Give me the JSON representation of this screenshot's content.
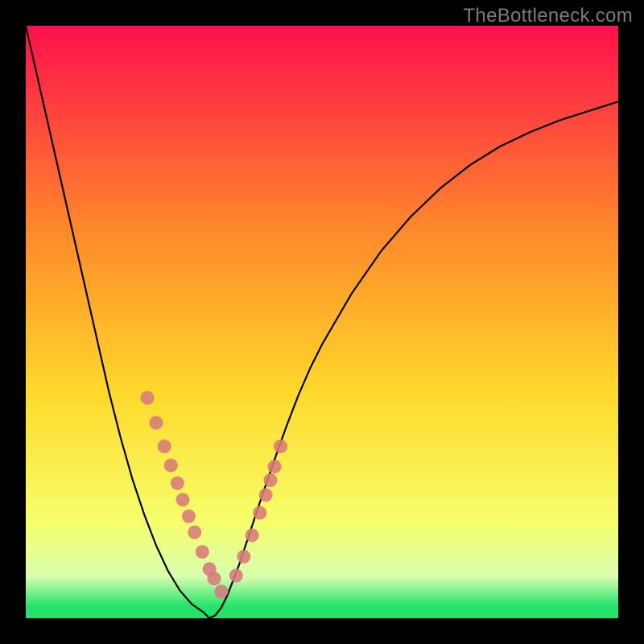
{
  "watermark": "TheBottleneck.com",
  "colors": {
    "gradient_top": "#ff0f4d",
    "gradient_upper_mid": "#ff8a2a",
    "gradient_mid": "#ffd92a",
    "gradient_lower_mid": "#f6ff6b",
    "gradient_above_green": "#d8ffb0",
    "gradient_green": "#23e36a",
    "curve": "#000000",
    "dot": "#d87a7a",
    "background": "#000000"
  },
  "chart_data": {
    "type": "line",
    "title": "",
    "xlabel": "",
    "ylabel": "",
    "x": [
      0.0,
      0.02,
      0.04,
      0.06,
      0.08,
      0.1,
      0.12,
      0.14,
      0.16,
      0.18,
      0.2,
      0.22,
      0.24,
      0.26,
      0.28,
      0.3,
      0.31,
      0.32,
      0.33,
      0.34,
      0.36,
      0.38,
      0.4,
      0.42,
      0.44,
      0.46,
      0.48,
      0.5,
      0.55,
      0.6,
      0.65,
      0.7,
      0.75,
      0.8,
      0.85,
      0.9,
      0.95,
      1.0
    ],
    "y": [
      1.0,
      0.912,
      0.824,
      0.736,
      0.648,
      0.56,
      0.472,
      0.384,
      0.305,
      0.235,
      0.175,
      0.123,
      0.08,
      0.047,
      0.024,
      0.01,
      0.0,
      0.005,
      0.018,
      0.038,
      0.09,
      0.15,
      0.21,
      0.268,
      0.324,
      0.376,
      0.422,
      0.462,
      0.548,
      0.62,
      0.678,
      0.726,
      0.765,
      0.796,
      0.82,
      0.84,
      0.856,
      0.872
    ],
    "xlim": [
      0,
      1
    ],
    "ylim": [
      0,
      1
    ],
    "series": [
      {
        "name": "bottleneck-curve",
        "role": "line",
        "color": "#000000"
      },
      {
        "name": "highlight-dots",
        "role": "scatter",
        "color": "#d87a7a",
        "points_x": [
          0.205,
          0.22,
          0.234,
          0.245,
          0.256,
          0.265,
          0.275,
          0.285,
          0.298,
          0.31,
          0.318,
          0.33,
          0.355,
          0.368,
          0.382,
          0.395,
          0.405,
          0.413,
          0.42,
          0.43
        ],
        "points_y": [
          0.372,
          0.33,
          0.29,
          0.258,
          0.228,
          0.2,
          0.172,
          0.145,
          0.112,
          0.083,
          0.067,
          0.045,
          0.072,
          0.104,
          0.14,
          0.178,
          0.208,
          0.233,
          0.256,
          0.29
        ]
      }
    ],
    "annotations": []
  }
}
